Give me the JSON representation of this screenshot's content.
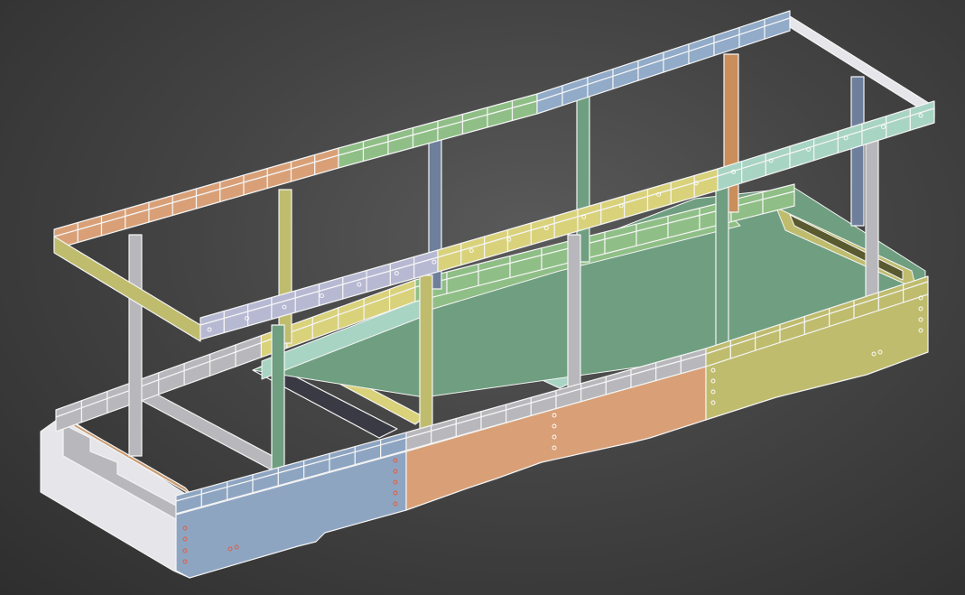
{
  "viewport": {
    "background": "#3c3c3c"
  },
  "model": {
    "colors": {
      "outline": "#f4f4f4",
      "outline_dark": "#2a2a2a",
      "peach": "#d9a077",
      "green": "#8fbf86",
      "steel_blue": "#91abc9",
      "mint": "#a8d4c4",
      "yellow": "#d9d27a",
      "lavender": "#b7b9d3",
      "grey": "#b8b8bc",
      "tan": "#c99a6e",
      "blue_panel": "#8ea5c2",
      "olive": "#bfbc6e",
      "white_frame": "#e6e6ea",
      "teal_post": "#6f9f80",
      "slate_post": "#6e7f9c",
      "orange_post": "#c98e5c",
      "dark_floor": "#3a3a44"
    },
    "hole_color": "#ffffff",
    "red_hole_color": "#e55a3c"
  }
}
